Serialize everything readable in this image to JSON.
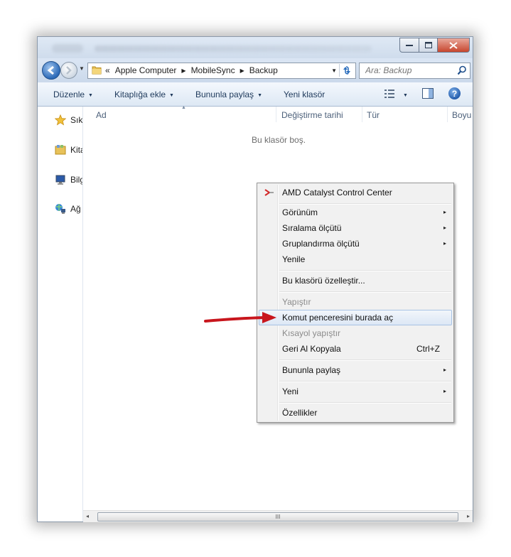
{
  "window": {
    "controls": {
      "minimize": "‒",
      "maximize": "▢",
      "close": "✕"
    }
  },
  "address": {
    "overflow": "«",
    "crumbs": [
      "Apple Computer",
      "MobileSync",
      "Backup"
    ],
    "search_placeholder": "Ara: Backup"
  },
  "toolbar": {
    "organize": "Düzenle",
    "include_library": "Kitaplığa ekle",
    "share_with": "Bununla paylaş",
    "new_folder": "Yeni klasör",
    "help": "?"
  },
  "nav": {
    "items": [
      {
        "label": "Sık",
        "icon": "star-icon"
      },
      {
        "label": "Kita",
        "icon": "library-icon"
      },
      {
        "label": "Bilg",
        "icon": "computer-icon"
      },
      {
        "label": "Ağ",
        "icon": "network-icon"
      }
    ]
  },
  "columns": [
    "Ad",
    "Değiştirme tarihi",
    "Tür",
    "Boyu"
  ],
  "empty_message": "Bu klasör boş.",
  "scrollbar": {
    "left": "◂",
    "right": "▸",
    "grip": "III"
  },
  "context_menu": {
    "items": [
      {
        "label": "AMD Catalyst Control Center",
        "icon": "amd-icon"
      },
      {
        "label": "Görünüm",
        "submenu": true
      },
      {
        "label": "Sıralama ölçütü",
        "submenu": true
      },
      {
        "label": "Gruplandırma ölçütü",
        "submenu": true
      },
      {
        "label": "Yenile"
      },
      {
        "label": "Bu klasörü özelleştir..."
      },
      {
        "label": "Yapıştır",
        "disabled": true
      },
      {
        "label": "Komut penceresini burada aç",
        "highlighted": true
      },
      {
        "label": "Kısayol yapıştır",
        "disabled": true
      },
      {
        "label": "Geri Al Kopyala",
        "shortcut": "Ctrl+Z"
      },
      {
        "label": "Bununla paylaş",
        "submenu": true
      },
      {
        "label": "Yeni",
        "submenu": true
      },
      {
        "label": "Özellikler"
      }
    ],
    "submenu_arrow": "▸"
  },
  "colors": {
    "accent_arrow": "#c8161d",
    "highlight_border": "#a8c3e4",
    "toolbar_text": "#1e395b"
  }
}
